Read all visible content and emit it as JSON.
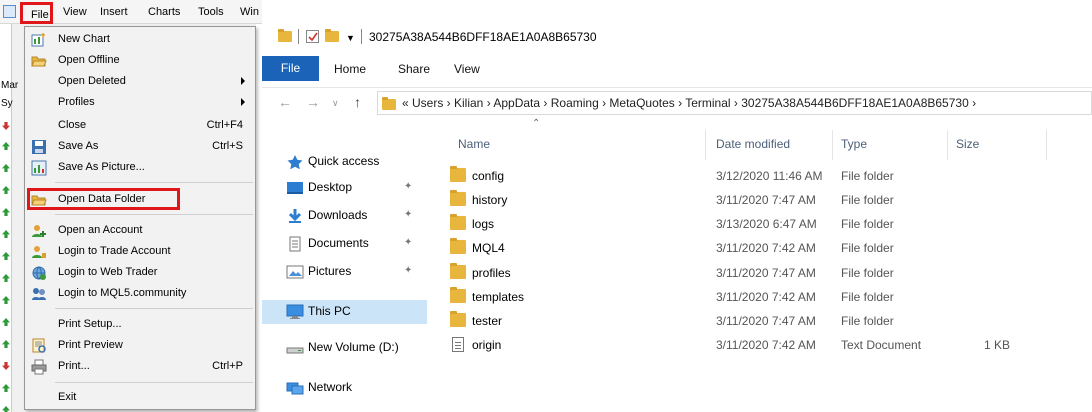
{
  "metatrader": {
    "menubar": [
      "File",
      "View",
      "Insert",
      "Charts",
      "Tools",
      "Win"
    ],
    "sidebar_labels": [
      "Mar",
      "Sy"
    ],
    "file_menu": {
      "items": [
        {
          "label": "New Chart",
          "icon": "new-chart-icon"
        },
        {
          "label": "Open Offline",
          "icon": "open-folder-icon"
        },
        {
          "label": "Open Deleted",
          "has_submenu": true
        },
        {
          "label": "Profiles",
          "has_submenu": true
        },
        {
          "label": "Close",
          "shortcut": "Ctrl+F4"
        },
        {
          "label": "Save As",
          "shortcut": "Ctrl+S",
          "icon": "save-icon"
        },
        {
          "label": "Save As Picture...",
          "icon": "save-picture-icon"
        },
        {
          "label": "Open Data Folder",
          "icon": "open-folder-icon",
          "highlighted": true
        },
        {
          "label": "Open an Account",
          "icon": "account-icon"
        },
        {
          "label": "Login to Trade Account",
          "icon": "login-icon"
        },
        {
          "label": "Login to Web Trader",
          "icon": "web-trader-icon"
        },
        {
          "label": "Login to MQL5.community",
          "icon": "mql5-icon"
        },
        {
          "label": "Print Setup..."
        },
        {
          "label": "Print Preview",
          "icon": "print-preview-icon"
        },
        {
          "label": "Print...",
          "shortcut": "Ctrl+P",
          "icon": "print-icon"
        },
        {
          "label": "Exit"
        }
      ]
    },
    "highlight_color": "#e0171a"
  },
  "explorer": {
    "title": "30275A38A544B6DFF18AE1A0A8B65730",
    "ribbon_tabs": [
      "File",
      "Home",
      "Share",
      "View"
    ],
    "address": "« Users › Kilian › AppData › Roaming › MetaQuotes › Terminal › 30275A38A544B6DFF18AE1A0A8B65730 ›",
    "nav_pane": [
      {
        "label": "Quick access",
        "icon": "star-icon"
      },
      {
        "label": "Desktop",
        "icon": "desktop-icon",
        "pinned": true
      },
      {
        "label": "Downloads",
        "icon": "download-arrow-icon",
        "pinned": true
      },
      {
        "label": "Documents",
        "icon": "documents-icon",
        "pinned": true
      },
      {
        "label": "Pictures",
        "icon": "pictures-icon",
        "pinned": true
      },
      {
        "label": "This PC",
        "icon": "computer-icon",
        "selected": true
      },
      {
        "label": "New Volume (D:)",
        "icon": "drive-icon"
      },
      {
        "label": "Network",
        "icon": "network-icon"
      }
    ],
    "columns": [
      "Name",
      "Date modified",
      "Type",
      "Size"
    ],
    "files": [
      {
        "name": "config",
        "date": "3/12/2020 11:46 AM",
        "type": "File folder",
        "size": ""
      },
      {
        "name": "history",
        "date": "3/11/2020 7:47 AM",
        "type": "File folder",
        "size": ""
      },
      {
        "name": "logs",
        "date": "3/13/2020 6:47 AM",
        "type": "File folder",
        "size": ""
      },
      {
        "name": "MQL4",
        "date": "3/11/2020 7:42 AM",
        "type": "File folder",
        "size": ""
      },
      {
        "name": "profiles",
        "date": "3/11/2020 7:47 AM",
        "type": "File folder",
        "size": ""
      },
      {
        "name": "templates",
        "date": "3/11/2020 7:42 AM",
        "type": "File folder",
        "size": ""
      },
      {
        "name": "tester",
        "date": "3/11/2020 7:47 AM",
        "type": "File folder",
        "size": ""
      },
      {
        "name": "origin",
        "date": "3/11/2020 7:42 AM",
        "type": "Text Document",
        "size": "1 KB"
      }
    ],
    "accent": "#1a63b8"
  }
}
